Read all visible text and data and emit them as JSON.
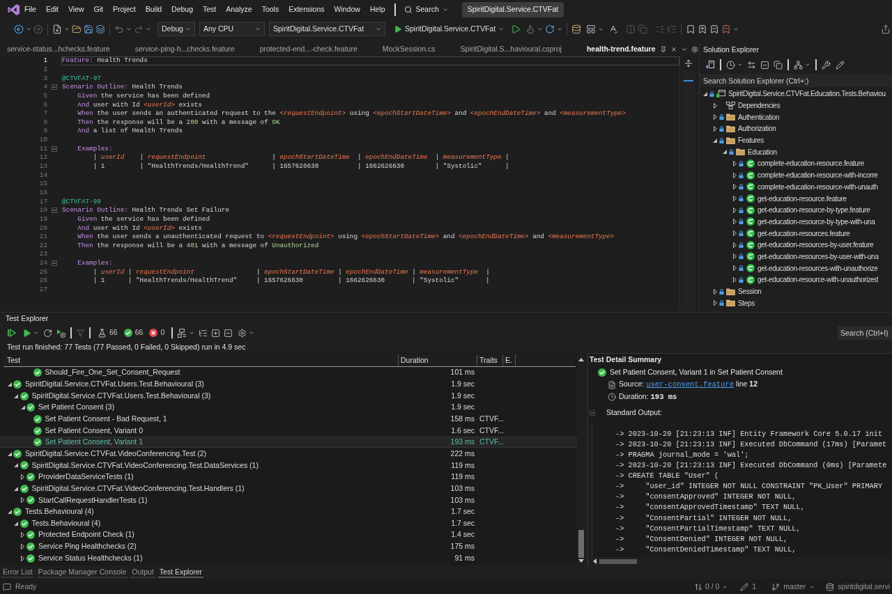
{
  "menu_bar": {
    "items": [
      "File",
      "Edit",
      "View",
      "Git",
      "Project",
      "Build",
      "Debug",
      "Test",
      "Analyze",
      "Tools",
      "Extensions",
      "Window",
      "Help"
    ],
    "search": "Search",
    "title": "SpiritDigital.Service.CTVFat"
  },
  "toolbar": {
    "configuration": "Debug",
    "platform": "Any CPU",
    "startup_project": "SpiritDigital.Service.CTVFat",
    "run_target": "SpiritDigital.Service.CTVFat"
  },
  "document_tabs": [
    {
      "label": "service-status...hchecks.feature",
      "selected": false
    },
    {
      "label": "service-ping-h...checks.feature",
      "selected": false
    },
    {
      "label": "protected-end...-check.feature",
      "selected": false
    },
    {
      "label": "MockSession.cs",
      "selected": false
    },
    {
      "label": "SpiritDigital.S...havioural.csproj",
      "selected": false
    },
    {
      "label": "health-trend.feature",
      "selected": true
    }
  ],
  "editor": {
    "lines": [
      {
        "number": "1",
        "current": true,
        "tokens": [
          {
            "kind": "keyword",
            "text": "Feature:"
          },
          {
            "kind": "text",
            "text": " Health Trends"
          }
        ]
      },
      {
        "number": "2",
        "current": false
      },
      {
        "number": "3",
        "current": false,
        "tokens": [
          {
            "kind": "tag",
            "text": "@CTVFAT-97"
          }
        ]
      },
      {
        "number": "4",
        "current": false,
        "expanded": true,
        "tokens": [
          {
            "kind": "keyword",
            "text": "Scenario Outline:"
          },
          {
            "kind": "text",
            "text": " Health Trends"
          }
        ]
      },
      {
        "number": "5",
        "current": false,
        "tokens": [
          {
            "kind": "keyword",
            "text": "    Given"
          },
          {
            "kind": "text",
            "text": " the service has been defined"
          }
        ]
      },
      {
        "number": "6",
        "current": false,
        "tokens": [
          {
            "kind": "keyword",
            "text": "    And"
          },
          {
            "kind": "text",
            "text": " user with Id "
          },
          {
            "kind": "param",
            "text": "<userId>"
          },
          {
            "kind": "text",
            "text": " exists"
          }
        ]
      },
      {
        "number": "7",
        "current": false,
        "tokens": [
          {
            "kind": "keyword",
            "text": "    When"
          },
          {
            "kind": "text",
            "text": " the user sends an authenticated request to the "
          },
          {
            "kind": "param",
            "text": "<requestEndpoint>"
          },
          {
            "kind": "text",
            "text": " using "
          },
          {
            "kind": "param",
            "text": "<epochStartDateTime>"
          },
          {
            "kind": "text",
            "text": " and "
          },
          {
            "kind": "param",
            "text": "<epochEndDateTime>"
          },
          {
            "kind": "text",
            "text": " and "
          },
          {
            "kind": "param",
            "text": "<measurementType>"
          }
        ]
      },
      {
        "number": "8",
        "current": false,
        "tokens": [
          {
            "kind": "keyword",
            "text": "    Then"
          },
          {
            "kind": "text",
            "text": " the response will be a "
          },
          {
            "kind": "value",
            "text": "200"
          },
          {
            "kind": "text",
            "text": " with a message of "
          },
          {
            "kind": "value",
            "text": "OK"
          }
        ]
      },
      {
        "number": "9",
        "current": false,
        "tokens": [
          {
            "kind": "keyword",
            "text": "    And"
          },
          {
            "kind": "text",
            "text": " a list of Health Trends"
          }
        ]
      },
      {
        "number": "10",
        "current": false
      },
      {
        "number": "11",
        "current": false,
        "expanded": true,
        "tokens": [
          {
            "kind": "keyword",
            "text": "    Examples:"
          }
        ]
      },
      {
        "number": "12",
        "current": false,
        "tokens": [
          {
            "kind": "text",
            "text": "        | "
          },
          {
            "kind": "param",
            "text": "userId"
          },
          {
            "kind": "text",
            "text": "    | "
          },
          {
            "kind": "param",
            "text": "requestEndpoint"
          },
          {
            "kind": "text",
            "text": "                 | "
          },
          {
            "kind": "param",
            "text": "epochStartDateTime"
          },
          {
            "kind": "text",
            "text": "  | "
          },
          {
            "kind": "param",
            "text": "epochEndDateTime"
          },
          {
            "kind": "text",
            "text": "  | "
          },
          {
            "kind": "param",
            "text": "measurementType"
          },
          {
            "kind": "text",
            "text": " |"
          }
        ]
      },
      {
        "number": "13",
        "current": false,
        "tokens": [
          {
            "kind": "text",
            "text": "        | 1         | \"HealthTrends/HealthTrend\"      | 1657626630          | 1662626630        | \"Systolic\"      |"
          }
        ]
      },
      {
        "number": "14",
        "current": false
      },
      {
        "number": "15",
        "current": false
      },
      {
        "number": "16",
        "current": false
      },
      {
        "number": "17",
        "current": false,
        "tokens": [
          {
            "kind": "tag",
            "text": "@CTVFAT-99"
          }
        ]
      },
      {
        "number": "18",
        "current": false,
        "expanded": true,
        "tokens": [
          {
            "kind": "keyword",
            "text": "Scenario Outline:"
          },
          {
            "kind": "text",
            "text": " Health Trends Set Failure"
          }
        ]
      },
      {
        "number": "19",
        "current": false,
        "tokens": [
          {
            "kind": "keyword",
            "text": "    Given"
          },
          {
            "kind": "text",
            "text": " the service has been defined"
          }
        ]
      },
      {
        "number": "20",
        "current": false,
        "tokens": [
          {
            "kind": "keyword",
            "text": "    And"
          },
          {
            "kind": "text",
            "text": " user with Id "
          },
          {
            "kind": "param",
            "text": "<userId>"
          },
          {
            "kind": "text",
            "text": " exists"
          }
        ]
      },
      {
        "number": "21",
        "current": false,
        "tokens": [
          {
            "kind": "keyword",
            "text": "    When"
          },
          {
            "kind": "text",
            "text": " the user sends a unauthenticated request to "
          },
          {
            "kind": "param",
            "text": "<requestEndpoint>"
          },
          {
            "kind": "text",
            "text": " using "
          },
          {
            "kind": "param",
            "text": "<epochStartDateTime>"
          },
          {
            "kind": "text",
            "text": " and "
          },
          {
            "kind": "param",
            "text": "<epochEndDateTime>"
          },
          {
            "kind": "text",
            "text": " and "
          },
          {
            "kind": "param",
            "text": "<measurementType>"
          }
        ]
      },
      {
        "number": "22",
        "current": false,
        "tokens": [
          {
            "kind": "keyword",
            "text": "    Then"
          },
          {
            "kind": "text",
            "text": " the response will be a "
          },
          {
            "kind": "value",
            "text": "401"
          },
          {
            "kind": "text",
            "text": " with a message of "
          },
          {
            "kind": "value",
            "text": "Unauthorized"
          }
        ]
      },
      {
        "number": "23",
        "current": false
      },
      {
        "number": "24",
        "current": false,
        "expanded": true,
        "tokens": [
          {
            "kind": "keyword",
            "text": "    Examples:"
          }
        ]
      },
      {
        "number": "25",
        "current": false,
        "tokens": [
          {
            "kind": "text",
            "text": "        | "
          },
          {
            "kind": "param",
            "text": "userId"
          },
          {
            "kind": "text",
            "text": " | "
          },
          {
            "kind": "param",
            "text": "requestEndpoint"
          },
          {
            "kind": "text",
            "text": "                | "
          },
          {
            "kind": "param",
            "text": "epochStartDateTime"
          },
          {
            "kind": "text",
            "text": " | "
          },
          {
            "kind": "param",
            "text": "epochEndDateTime"
          },
          {
            "kind": "text",
            "text": " | "
          },
          {
            "kind": "param",
            "text": "measurementType"
          },
          {
            "kind": "text",
            "text": "  |"
          }
        ]
      },
      {
        "number": "26",
        "current": false,
        "tokens": [
          {
            "kind": "text",
            "text": "        | 1      | \"HealthTrends/HealthTrend\"     | 1657626630         | 1662626630       | \"Systolic\"       |"
          }
        ]
      },
      {
        "number": "27",
        "current": false
      }
    ]
  },
  "solution_explorer": {
    "title": "Solution Explorer",
    "search": {
      "placeholder": "Search Solution Explorer (Ctrl+;)"
    },
    "tree": [
      {
        "kind": "project",
        "name": "SpiritDigital.Service.CTVFat.Education.Tests.Behaviou",
        "locked": true,
        "expanded": true,
        "children": [
          {
            "kind": "dependencies",
            "name": "Dependencies",
            "locked": false,
            "expanded": false
          },
          {
            "kind": "folder",
            "name": "Authentication",
            "locked": true,
            "expanded": false
          },
          {
            "kind": "folder",
            "name": "Authorization",
            "locked": true,
            "expanded": false
          },
          {
            "kind": "folder",
            "name": "Features",
            "locked": true,
            "expanded": true,
            "children": [
              {
                "kind": "folder",
                "name": "Education",
                "locked": true,
                "expanded": true,
                "children": [
                  {
                    "kind": "feature",
                    "name": "complete-education-resource.feature",
                    "locked": true,
                    "expanded": false
                  },
                  {
                    "kind": "feature",
                    "name": "complete-education-resource-with-incorre",
                    "locked": true,
                    "expanded": false
                  },
                  {
                    "kind": "feature",
                    "name": "complete-education-resource-with-unauth",
                    "locked": true,
                    "expanded": false
                  },
                  {
                    "kind": "feature",
                    "name": "get-education-resource.feature",
                    "locked": true,
                    "expanded": false
                  },
                  {
                    "kind": "feature",
                    "name": "get-education-resource-by-type.feature",
                    "locked": true,
                    "expanded": false
                  },
                  {
                    "kind": "feature",
                    "name": "get-education-resource-by-type-with-una",
                    "locked": true,
                    "expanded": false
                  },
                  {
                    "kind": "feature",
                    "name": "get-education-resources.feature",
                    "locked": true,
                    "expanded": false
                  },
                  {
                    "kind": "feature",
                    "name": "get-education-resources-by-user.feature",
                    "locked": true,
                    "expanded": false
                  },
                  {
                    "kind": "feature",
                    "name": "get-education-resources-by-user-with-una",
                    "locked": true,
                    "expanded": false
                  },
                  {
                    "kind": "feature",
                    "name": "get-education-resources-with-unauthorize",
                    "locked": true,
                    "expanded": false
                  },
                  {
                    "kind": "feature",
                    "name": "get-education-resource-with-unauthorized",
                    "locked": true,
                    "expanded": false
                  }
                ]
              }
            ]
          },
          {
            "kind": "folder",
            "name": "Session",
            "locked": true,
            "expanded": false
          },
          {
            "kind": "folder",
            "name": "Steps",
            "locked": true,
            "expanded": false
          }
        ]
      }
    ]
  },
  "test_explorer": {
    "title": "Test Explorer",
    "counts": {
      "total": "66",
      "passed": "66",
      "failed": "0"
    },
    "search": {
      "placeholder": "Search (Ctrl+I)"
    },
    "status": "Test run finished: 77 Tests (77 Passed, 0 Failed, 0 Skipped) run in 4.9 sec",
    "columns": [
      "Test",
      "Duration",
      "Traits",
      "E."
    ],
    "continued_rows": [
      {
        "name": "Should_Fire_One_Set_Consent_Request",
        "duration": "101 ms",
        "passed": true,
        "selected": false
      }
    ],
    "tree": [
      {
        "name": "SpiritDigital.Service.CTVFat.Users.Test.Behavioural (3)",
        "duration": "1.9 sec",
        "passed": true,
        "expanded": true,
        "selected": false,
        "children": [
          {
            "name": "SpiritDigital.Service.CTVFat.Users.Test.Behavioural (3)",
            "duration": "1.9 sec",
            "passed": true,
            "expanded": true,
            "selected": false,
            "children": [
              {
                "name": "Set Patient Consent (3)",
                "duration": "1.9 sec",
                "passed": true,
                "expanded": true,
                "selected": false,
                "children": [
                  {
                    "name": "Set Patient Consent - Bad Request, 1",
                    "duration": "158 ms",
                    "traits": "CTVF...",
                    "passed": true,
                    "selected": false
                  },
                  {
                    "name": "Set Patient Consent, Variant 0",
                    "duration": "1.6 sec",
                    "traits": "CTVF...",
                    "passed": true,
                    "selected": false
                  },
                  {
                    "name": "Set Patient Consent, Variant 1",
                    "duration": "193 ms",
                    "traits": "CTVF...",
                    "passed": true,
                    "selected": true
                  }
                ]
              }
            ]
          }
        ]
      },
      {
        "name": "SpiritDigital.Service.CTVFat.VideoConferencing.Test (2)",
        "duration": "222 ms",
        "passed": true,
        "expanded": true,
        "selected": false,
        "children": [
          {
            "name": "SpiritDigital.Service.CTVFat.VideoConferencing.Test.DataServices (1)",
            "duration": "119 ms",
            "passed": true,
            "expanded": true,
            "selected": false,
            "children": [
              {
                "name": "ProviderDataServiceTests (1)",
                "duration": "119 ms",
                "passed": true,
                "expanded": false,
                "selected": false
              }
            ]
          },
          {
            "name": "SpiritDigital.Service.CTVFat.VideoConferencing.Test.Handlers (1)",
            "duration": "103 ms",
            "passed": true,
            "expanded": true,
            "selected": false,
            "children": [
              {
                "name": "StartCallRequestHandlerTests (1)",
                "duration": "103 ms",
                "passed": true,
                "expanded": false,
                "selected": false
              }
            ]
          }
        ]
      },
      {
        "name": "Tests.Behavioural (4)",
        "duration": "1.7 sec",
        "passed": true,
        "expanded": true,
        "selected": false,
        "children": [
          {
            "name": "Tests.Behavioural (4)",
            "duration": "1.7 sec",
            "passed": true,
            "expanded": true,
            "selected": false,
            "children": [
              {
                "name": "Protected Endpoint Check (1)",
                "duration": "1.4 sec",
                "passed": true,
                "expanded": false,
                "selected": false
              },
              {
                "name": "Service Ping Healthchecks (2)",
                "duration": "175 ms",
                "passed": true,
                "expanded": false,
                "selected": false
              },
              {
                "name": "Service Status Healthchecks (1)",
                "duration": "91 ms",
                "passed": true,
                "expanded": false,
                "selected": false
              }
            ]
          }
        ]
      }
    ]
  },
  "test_detail": {
    "title": "Test Detail Summary",
    "test_name": "Set Patient Consent, Variant 1 in Set Patient Consent",
    "passed": true,
    "source_label": "Source:",
    "source_file": "user-consent.feature",
    "source_line": "line **12**",
    "duration_label": "Duration:",
    "duration": "193 ms",
    "output_title": "Standard Output:",
    "output_lines": [
      "-> 2023-10-20 [21:23:13 INF] Entity Framework Core 5.0.17 init",
      "-> 2023-10-20 [21:23:13 INF] Executed DbCommand (17ms) [Paramet",
      "-> PRAGMA journal_mode = 'wal';",
      "-> 2023-10-20 [21:23:13 INF] Executed DbCommand (0ms) [Paramete",
      "-> CREATE TABLE \"User\" (",
      "->     \"user_id\" INTEGER NOT NULL CONSTRAINT \"PK_User\" PRIMARY",
      "->     \"consentApproved\" INTEGER NOT NULL,",
      "->     \"consentApprovedTimestamp\" TEXT NULL,",
      "->     \"ConsentPartial\" INTEGER NOT NULL,",
      "->     \"ConsentPartialTimestamp\" TEXT NULL,",
      "->     \"ConsentDenied\" INTEGER NOT NULL,",
      "->     \"ConsentDeniedTimestamp\" TEXT NULL,"
    ]
  },
  "bottom_tabs": [
    {
      "label": "Error List",
      "selected": false
    },
    {
      "label": "Package Manager Console",
      "selected": false
    },
    {
      "label": "Output",
      "selected": false
    },
    {
      "label": "Test Explorer",
      "selected": true
    }
  ],
  "status_bar": {
    "message": "Ready",
    "changes": "0 / 0",
    "edits": "1",
    "branch": "master",
    "repository": "spiritdigital.servi"
  }
}
